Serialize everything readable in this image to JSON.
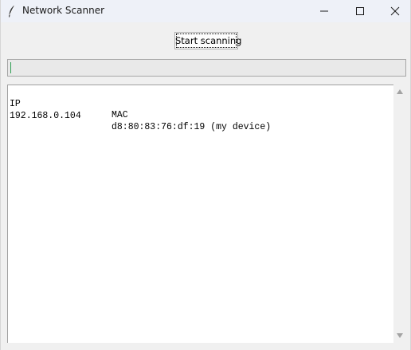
{
  "window": {
    "title": "Network Scanner",
    "icon": "feather-icon",
    "controls": [
      "minimize-icon",
      "maximize-icon",
      "close-icon"
    ]
  },
  "scan_button": {
    "label": "Start scanning"
  },
  "entry": {
    "value": ""
  },
  "results": {
    "headers": {
      "ip": "IP",
      "mac": "MAC"
    },
    "rows": [
      {
        "ip": "192.168.0.104",
        "mac": "d8:80:83:76:df:19 (my device)"
      }
    ]
  },
  "colors": {
    "titlebar": "#eef1f8",
    "window": "#f0f0f0",
    "caret": "#2f9f52"
  }
}
